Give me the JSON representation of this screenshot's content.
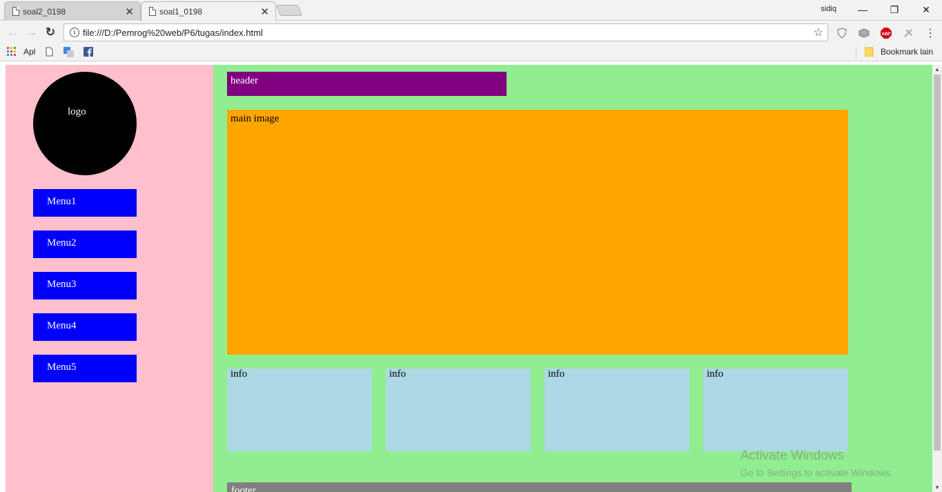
{
  "tabs": [
    {
      "title": "soal2_0198",
      "close": "✕"
    },
    {
      "title": "soal1_0198",
      "close": "✕"
    }
  ],
  "profile": "sidiq",
  "window": {
    "minimize": "—",
    "restore": "❐",
    "close": "✕"
  },
  "nav": {
    "back": "←",
    "forward": "→",
    "reload": "↻"
  },
  "address": {
    "info": "i",
    "url": "file:///D:/Pemrog%20web/P6/tugas/index.html",
    "star": "☆"
  },
  "extensions": {
    "menu": "⋮",
    "abp": "ABP"
  },
  "bookmarks": {
    "apps": "Apl",
    "other": "Bookmark lain"
  },
  "page": {
    "logo": "logo",
    "menus": [
      "Menu1",
      "Menu2",
      "Menu3",
      "Menu4",
      "Menu5"
    ],
    "header": "header",
    "main_image": "main image",
    "infos": [
      "info",
      "info",
      "info",
      "info"
    ],
    "footer": "footer"
  },
  "watermark": {
    "line1": "Activate Windows",
    "line2": "Go to Settings to activate Windows."
  },
  "colors": {
    "sidebar": "#ffc0cb",
    "content": "#90ee90",
    "header": "#800080",
    "main": "#ffa500",
    "info": "#add8e6",
    "menu": "#0000ff",
    "footer": "#808080"
  }
}
